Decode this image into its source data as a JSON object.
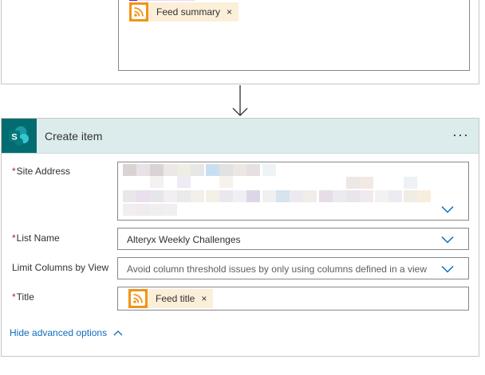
{
  "previous_action": {
    "token": {
      "icon": "rss-icon",
      "label": "Feed summary",
      "remove": "×"
    }
  },
  "action": {
    "icon": "sharepoint-icon",
    "title": "Create item",
    "more_label": "···",
    "fields": [
      {
        "label": "Site Address",
        "required": true,
        "value": "",
        "obscured": true
      },
      {
        "label": "List Name",
        "required": true,
        "value": "Alteryx Weekly Challenges"
      },
      {
        "label": "Limit Columns by View",
        "required": false,
        "placeholder": "Avoid column threshold issues by only using columns defined in a view"
      },
      {
        "label": "Title",
        "required": true,
        "token": {
          "icon": "rss-icon",
          "label": "Feed title",
          "remove": "×"
        }
      }
    ],
    "advanced_toggle": "Hide advanced options"
  },
  "required_marker": "*",
  "colors": {
    "header_bg": "#dcecec",
    "sharepoint": "#036c70",
    "rss": "#f29418",
    "token_bg": "#fcefd9",
    "link": "#0f6cbd",
    "required": "#a4262c"
  }
}
